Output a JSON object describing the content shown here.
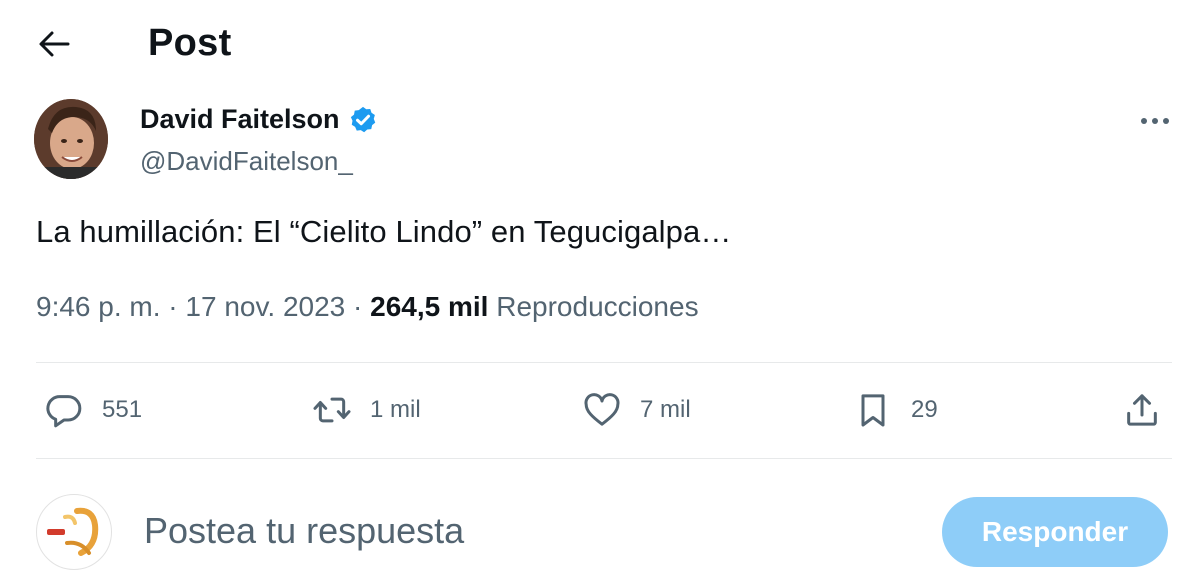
{
  "header": {
    "title": "Post"
  },
  "author": {
    "name": "David Faitelson",
    "handle": "@DavidFaitelson_",
    "verified": true
  },
  "tweet": {
    "text": "La humillación: El “Cielito Lindo” en Tegucigalpa…"
  },
  "meta": {
    "time": "9:46 p. m.",
    "sep1": "·",
    "date": "17 nov. 2023",
    "sep2": "·",
    "views_count": "264,5 mil",
    "views_label": "Reproducciones"
  },
  "actions": {
    "replies": "551",
    "reposts": "1 mil",
    "likes": "7 mil",
    "bookmarks": "29"
  },
  "reply": {
    "placeholder": "Postea tu respuesta",
    "button": "Responder"
  },
  "colors": {
    "accent": "#1d9bf0",
    "reply_button": "#8ecdf8",
    "muted": "#536471",
    "text": "#0f1419"
  },
  "icons": [
    "back-arrow-icon",
    "verified-badge-icon",
    "more-icon",
    "reply-icon",
    "repost-icon",
    "like-icon",
    "bookmark-icon",
    "share-icon"
  ]
}
